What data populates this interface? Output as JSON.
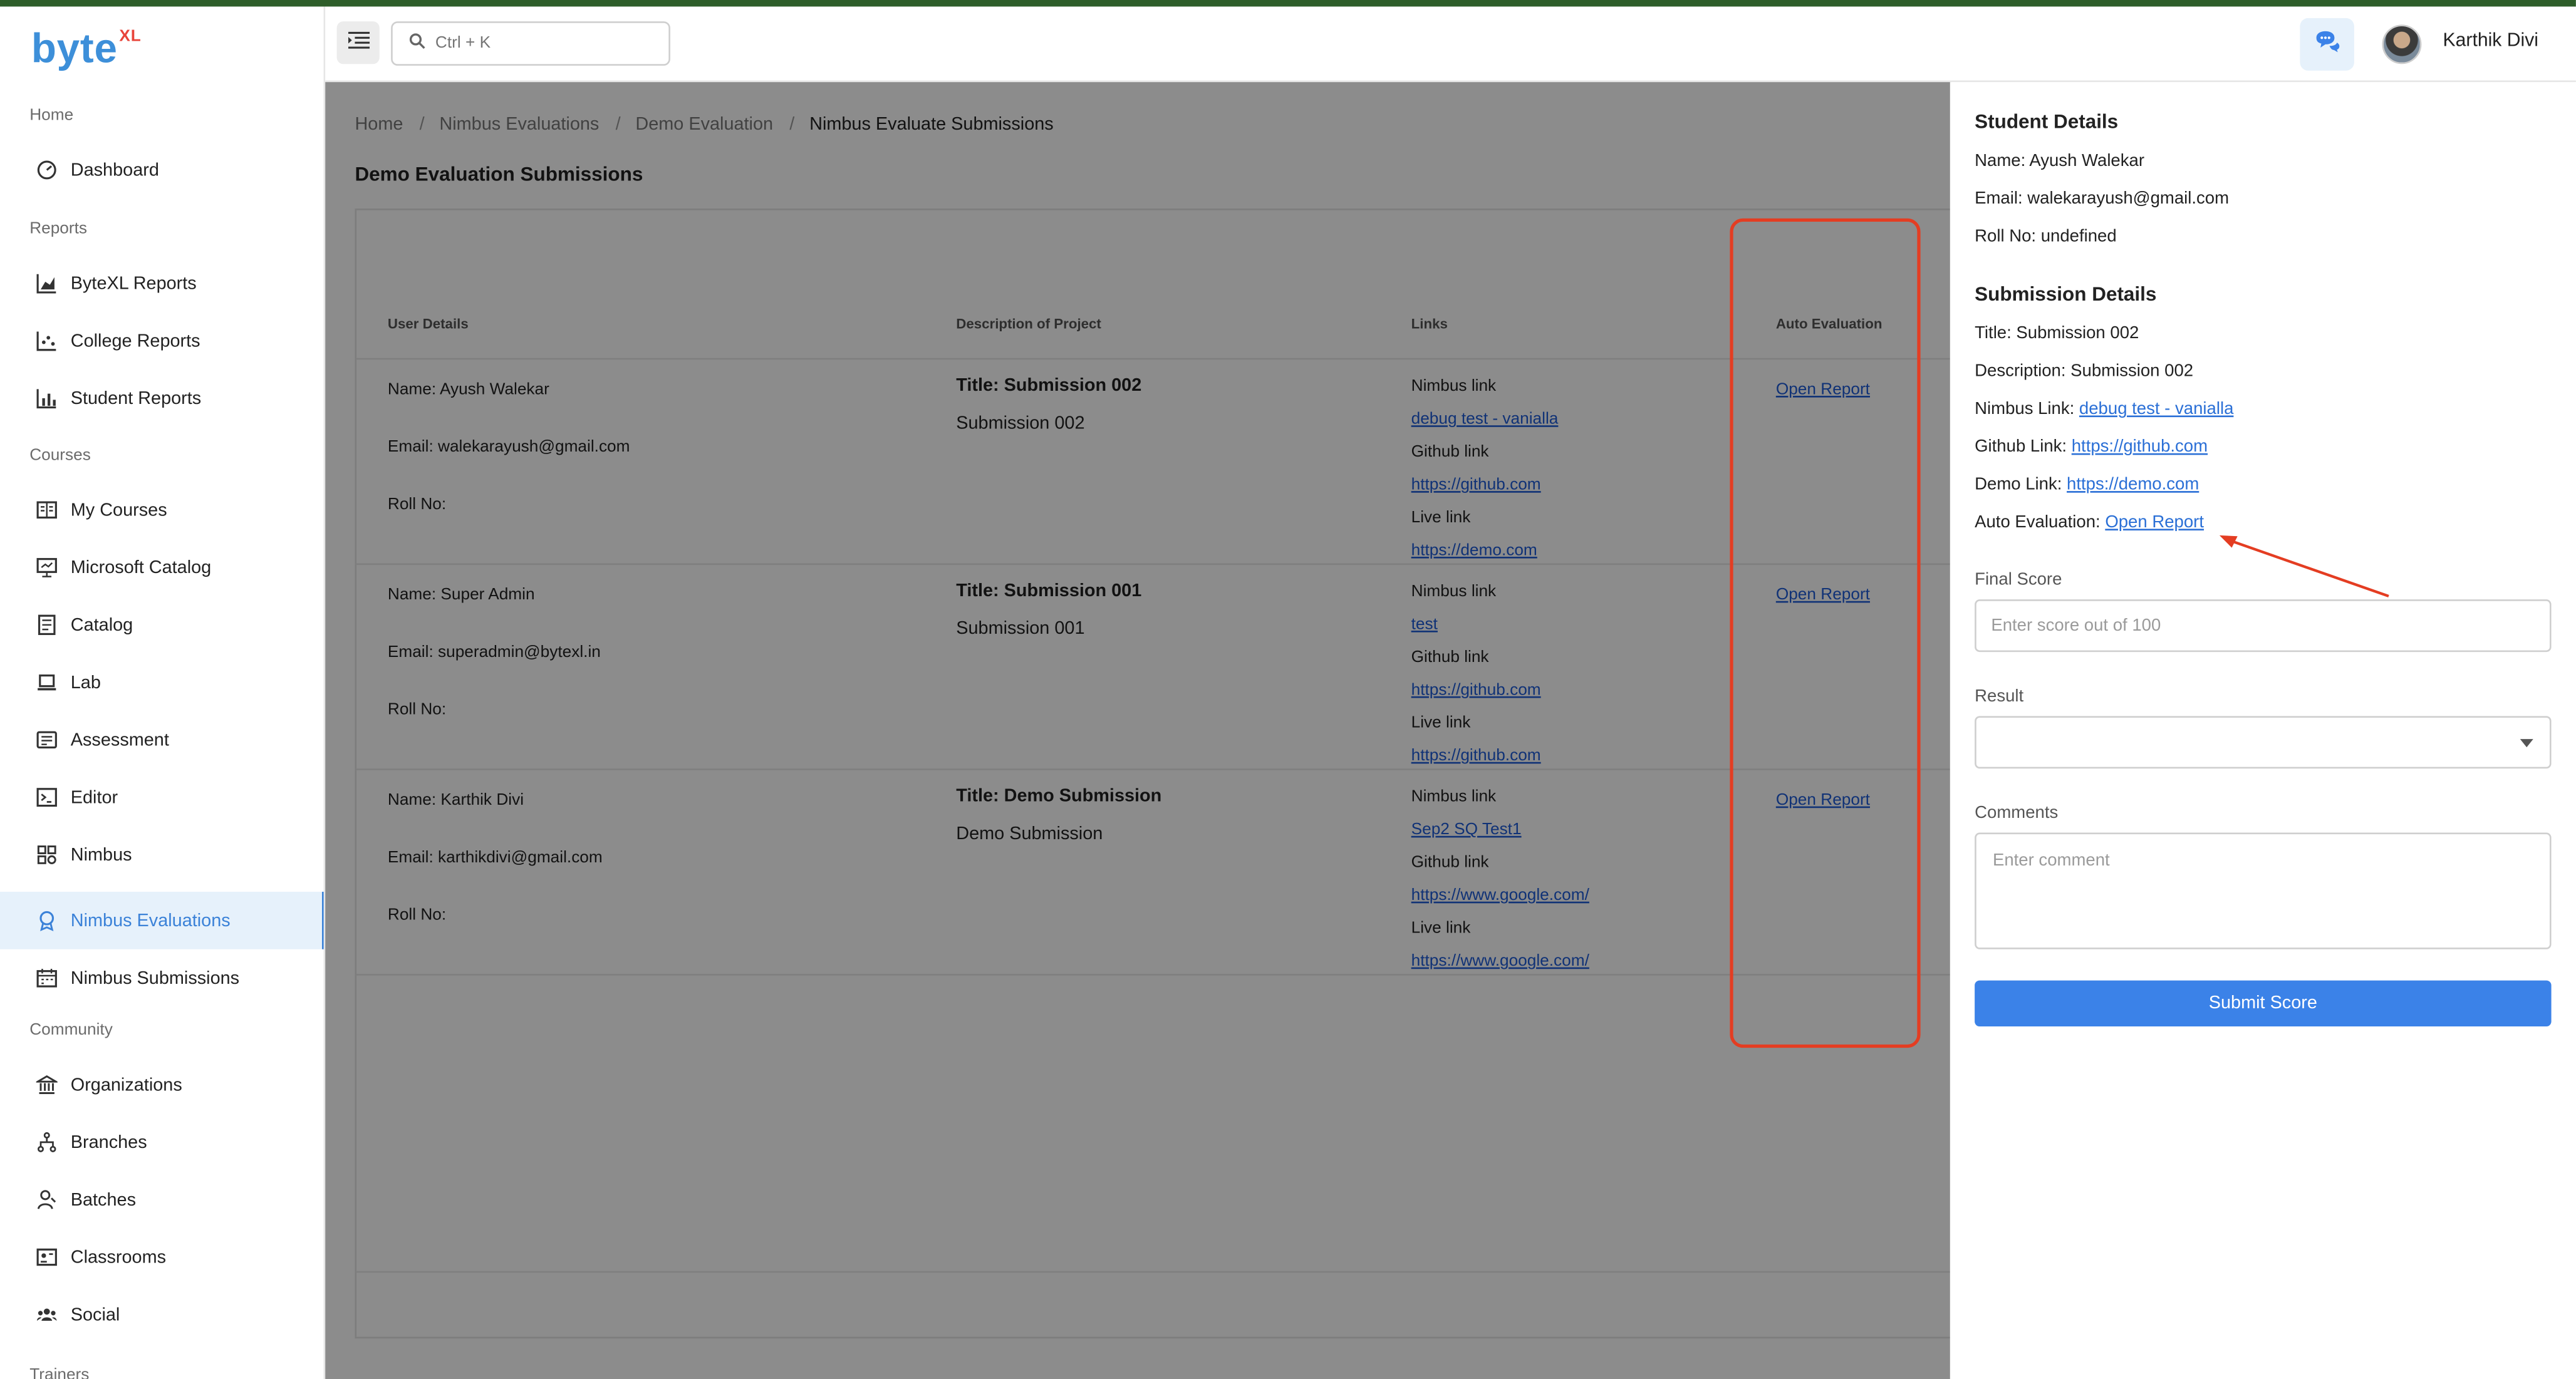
{
  "app": {
    "logo_text": "byte",
    "logo_sup": "XL",
    "user_name": "Karthik Divi"
  },
  "search": {
    "placeholder": "Ctrl + K"
  },
  "sidebar": {
    "sections": [
      "Home",
      "Reports",
      "Courses",
      "Community",
      "Trainers"
    ],
    "items": [
      {
        "label": "Dashboard",
        "icon": "dashboard-icon"
      },
      {
        "label": "ByteXL Reports",
        "icon": "area-chart-icon"
      },
      {
        "label": "College Reports",
        "icon": "scatter-chart-icon"
      },
      {
        "label": "Student Reports",
        "icon": "bar-chart-icon"
      },
      {
        "label": "My Courses",
        "icon": "book-icon"
      },
      {
        "label": "Microsoft Catalog",
        "icon": "presentation-icon"
      },
      {
        "label": "Catalog",
        "icon": "catalog-icon"
      },
      {
        "label": "Lab",
        "icon": "laptop-icon"
      },
      {
        "label": "Assessment",
        "icon": "assessment-icon"
      },
      {
        "label": "Editor",
        "icon": "terminal-icon"
      },
      {
        "label": "Nimbus",
        "icon": "apps-icon"
      },
      {
        "label": "Nimbus Evaluations",
        "icon": "badge-icon",
        "active": true
      },
      {
        "label": "Nimbus Submissions",
        "icon": "calendar-icon"
      },
      {
        "label": "Organizations",
        "icon": "bank-icon"
      },
      {
        "label": "Branches",
        "icon": "branch-icon"
      },
      {
        "label": "Batches",
        "icon": "person-icon"
      },
      {
        "label": "Classrooms",
        "icon": "classroom-icon"
      },
      {
        "label": "Social",
        "icon": "group-icon"
      }
    ]
  },
  "breadcrumb": [
    "Home",
    "Nimbus Evaluations",
    "Demo Evaluation",
    "Nimbus Evaluate Submissions"
  ],
  "page_title": "Demo Evaluation Submissions",
  "table": {
    "headers": [
      "User Details",
      "Description of Project",
      "Links",
      "Auto Evaluation"
    ],
    "rows": [
      {
        "name": "Name: Ayush Walekar",
        "email": "Email: walekarayush@gmail.com",
        "roll": "Roll No:",
        "title": "Title: Submission 002",
        "desc": "Submission 002",
        "nimbus_label": "Nimbus link",
        "nimbus": "debug test - vanialla",
        "github_label": "Github link",
        "github": "https://github.com",
        "live_label": "Live link",
        "live": "https://demo.com",
        "report": "Open Report"
      },
      {
        "name": "Name: Super Admin",
        "email": "Email: superadmin@bytexl.in",
        "roll": "Roll No:",
        "title": "Title: Submission 001",
        "desc": "Submission 001",
        "nimbus_label": "Nimbus link",
        "nimbus": "test",
        "github_label": "Github link",
        "github": "https://github.com",
        "live_label": "Live link",
        "live": "https://github.com",
        "report": "Open Report"
      },
      {
        "name": "Name: Karthik Divi",
        "email": "Email: karthikdivi@gmail.com",
        "roll": "Roll No:",
        "title": "Title: Demo Submission",
        "desc": "Demo Submission",
        "nimbus_label": "Nimbus link",
        "nimbus": "Sep2 SQ Test1",
        "github_label": "Github link",
        "github": "https://www.google.com/",
        "live_label": "Live link",
        "live": "https://www.google.com/",
        "report": "Open Report"
      }
    ]
  },
  "drawer": {
    "student_heading": "Student Details",
    "name": "Name: Ayush Walekar",
    "email": "Email: walekarayush@gmail.com",
    "roll": "Roll No: undefined",
    "submission_heading": "Submission Details",
    "title": "Title: Submission 002",
    "description": "Description: Submission 002",
    "nimbus_label": "Nimbus Link: ",
    "nimbus_link": "debug test - vanialla",
    "github_label": "Github Link: ",
    "github_link": "https://github.com",
    "demo_label": "Demo Link: ",
    "demo_link": "https://demo.com",
    "auto_label": "Auto Evaluation: ",
    "auto_link": "Open Report",
    "final_score_label": "Final Score",
    "final_score_placeholder": "Enter score out of 100",
    "result_label": "Result",
    "result_value": "",
    "comments_label": "Comments",
    "comments_placeholder": "Enter comment",
    "submit_label": "Submit Score"
  },
  "colors": {
    "accent": "#3b82e8",
    "annotation": "#e43d22",
    "brand": "#3d8fd9"
  }
}
